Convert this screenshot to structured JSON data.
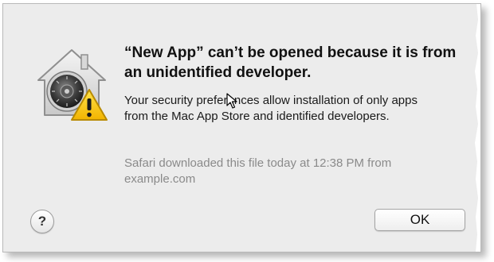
{
  "dialog": {
    "title": "“New App” can’t be opened because it is from an unidentified developer.",
    "message": "Your security preferences allow installation of only apps from the Mac App Store and identified developers.",
    "source_info": "Safari downloaded this file today at 12:38 PM from example.com",
    "icon": "gatekeeper-warning-icon",
    "help_label": "?",
    "ok_label": "OK"
  },
  "colors": {
    "background": "#ececec",
    "warning": "#f5c400",
    "muted_text": "#8a8a8a"
  }
}
